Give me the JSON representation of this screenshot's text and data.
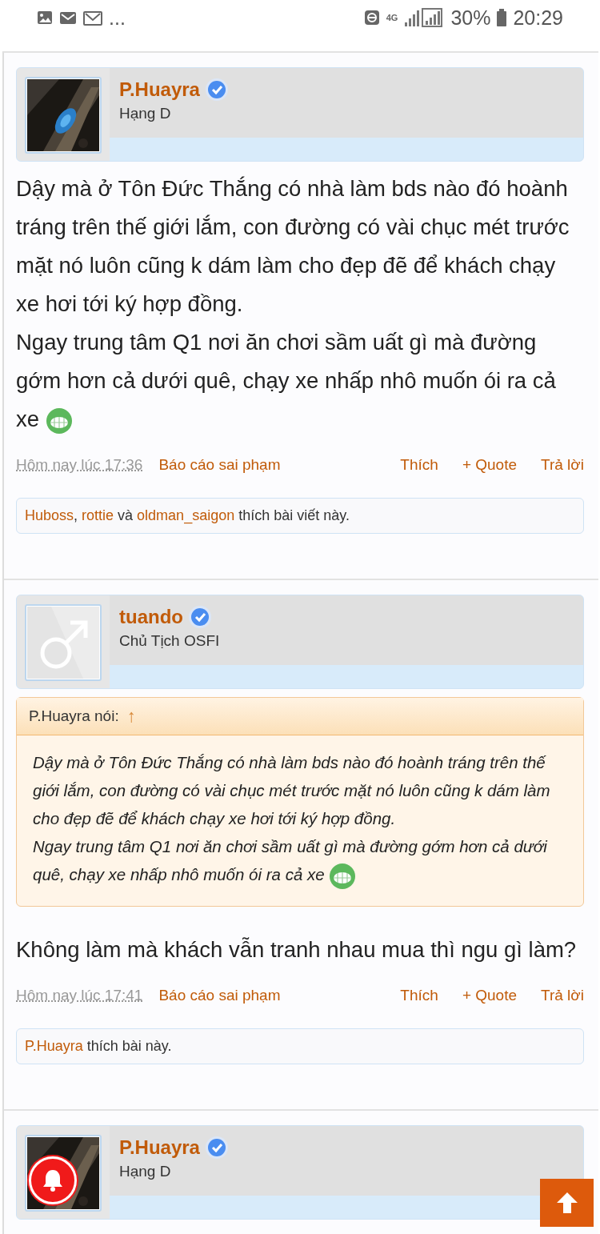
{
  "status_bar": {
    "overflow": "...",
    "network": "4G",
    "battery": "30%",
    "time": "20:29"
  },
  "posts": [
    {
      "avatar": {
        "kind": "picture"
      },
      "username": "P.Huayra",
      "verified": true,
      "rank": "Hạng D",
      "body": [
        {
          "text": "Dậy mà ở Tôn Đức Thắng có nhà làm bds nào đó hoành tráng trên thế giới lắm, con đường có vài chục mét trước mặt nó luôn cũng k dám làm cho đẹp đẽ để khách chạy xe hơi tới ký hợp đồng.",
          "smiley": false
        },
        {
          "text": "Ngay trung tâm Q1 nơi ăn chơi sầm uất gì mà đường gớm hơn cả dưới quê, chạy xe nhấp nhô muốn ói ra cả xe",
          "smiley": true
        }
      ],
      "time": "Hôm nay lúc 17:36",
      "report": "Báo cáo sai phạm",
      "actions": [
        "Thích",
        "+ Quote",
        "Trả lời"
      ],
      "likes": [
        {
          "kind": "user",
          "text": "Huboss"
        },
        {
          "kind": "plain",
          "text": ", "
        },
        {
          "kind": "user",
          "text": "rottie"
        },
        {
          "kind": "plain",
          "text": " và "
        },
        {
          "kind": "user",
          "text": "oldman_saigon"
        },
        {
          "kind": "plain",
          "text": " thích bài viết này."
        }
      ]
    },
    {
      "avatar": {
        "kind": "default"
      },
      "username": "tuando",
      "verified": true,
      "rank": "Chủ Tịch OSFI",
      "quote": {
        "author": "P.Huayra nói:",
        "arrow": "↑",
        "body": [
          {
            "text": "Dậy mà ở Tôn Đức Thắng có nhà làm bds nào đó hoành tráng trên thế giới lắm, con đường có vài chục mét trước mặt nó luôn cũng k dám làm cho đẹp đẽ để khách chạy xe hơi tới ký hợp đồng.",
            "smiley": false
          },
          {
            "text": "Ngay trung tâm Q1 nơi ăn chơi sầm uất gì mà đường gớm hơn cả dưới quê, chạy xe nhấp nhô muốn ói ra cả xe",
            "smiley": true
          }
        ]
      },
      "body": [
        {
          "text": "Không làm mà khách vẫn tranh nhau mua thì ngu gì làm?",
          "smiley": false
        }
      ],
      "time": "Hôm nay lúc 17:41",
      "report": "Báo cáo sai phạm",
      "actions": [
        "Thích",
        "+ Quote",
        "Trả lời"
      ],
      "likes": [
        {
          "kind": "user",
          "text": "P.Huayra"
        },
        {
          "kind": "plain",
          "text": " thích bài này."
        }
      ]
    },
    {
      "avatar": {
        "kind": "picture"
      },
      "username": "P.Huayra",
      "verified": true,
      "rank": "Hạng D"
    }
  ]
}
